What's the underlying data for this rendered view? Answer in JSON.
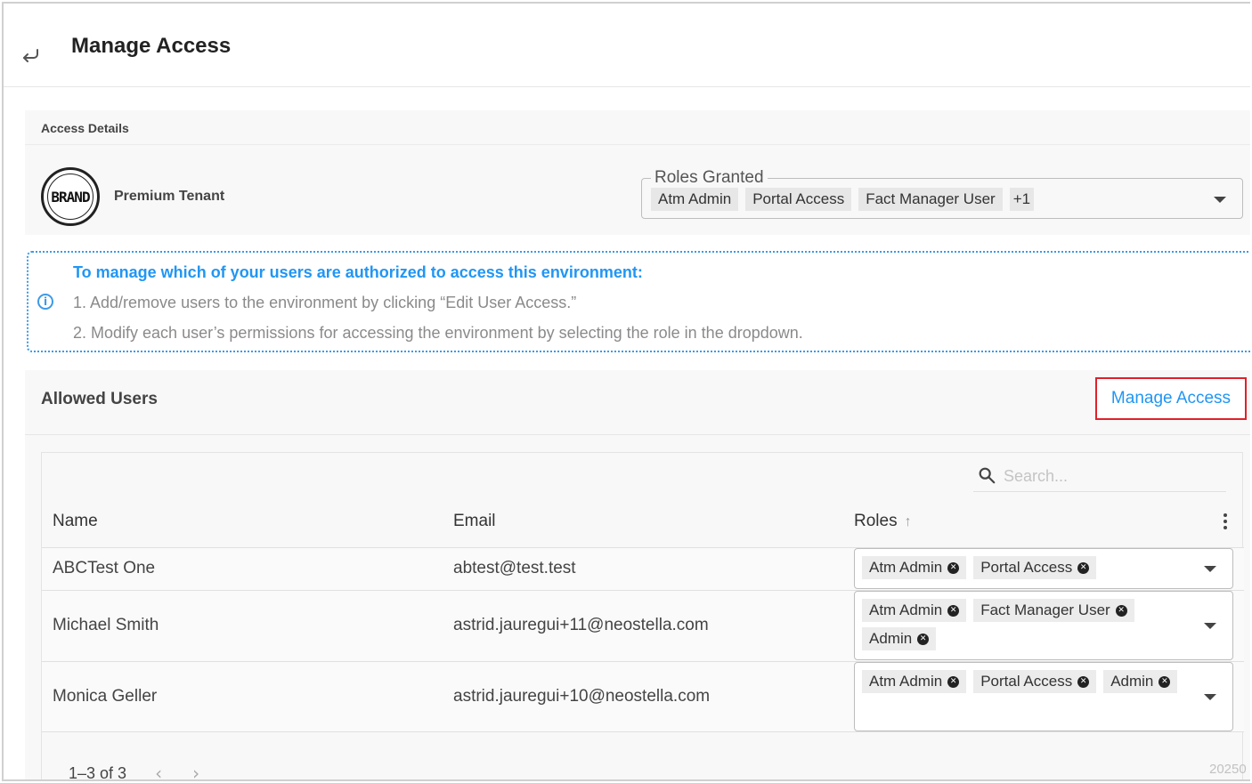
{
  "header": {
    "title": "Manage Access",
    "back_icon": "back-arrow-icon"
  },
  "access_details": {
    "title": "Access Details",
    "tenant_name": "Premium Tenant",
    "logo_text": "BRAND",
    "roles_granted": {
      "label": "Roles Granted",
      "chips": [
        "Atm Admin",
        "Portal Access",
        "Fact Manager User"
      ],
      "more": "+1"
    }
  },
  "info": {
    "title": "To manage which of your users are authorized to access this environment:",
    "line1": "1. Add/remove users to the environment by clicking “Edit User Access.”",
    "line2": "2. Modify each user’s permissions for accessing the environment by selecting the role in the dropdown.",
    "color": "#2196f3"
  },
  "allowed_users": {
    "title": "Allowed Users",
    "manage_button": "Manage Access",
    "search": {
      "placeholder": "Search..."
    },
    "columns": {
      "name": "Name",
      "email": "Email",
      "roles": "Roles"
    },
    "rows": [
      {
        "name": "ABCTest One",
        "email": "abtest@test.test",
        "roles": [
          "Atm Admin",
          "Portal Access"
        ]
      },
      {
        "name": "Michael Smith",
        "email": "astrid.jauregui+11@neostella.com",
        "roles": [
          "Atm Admin",
          "Fact Manager User",
          "Admin"
        ]
      },
      {
        "name": "Monica Geller",
        "email": "astrid.jauregui+10@neostella.com",
        "roles": [
          "Atm Admin",
          "Portal Access",
          "Admin"
        ]
      }
    ],
    "pagination": {
      "range": "1–3 of 3"
    }
  },
  "corner_text": "20250"
}
